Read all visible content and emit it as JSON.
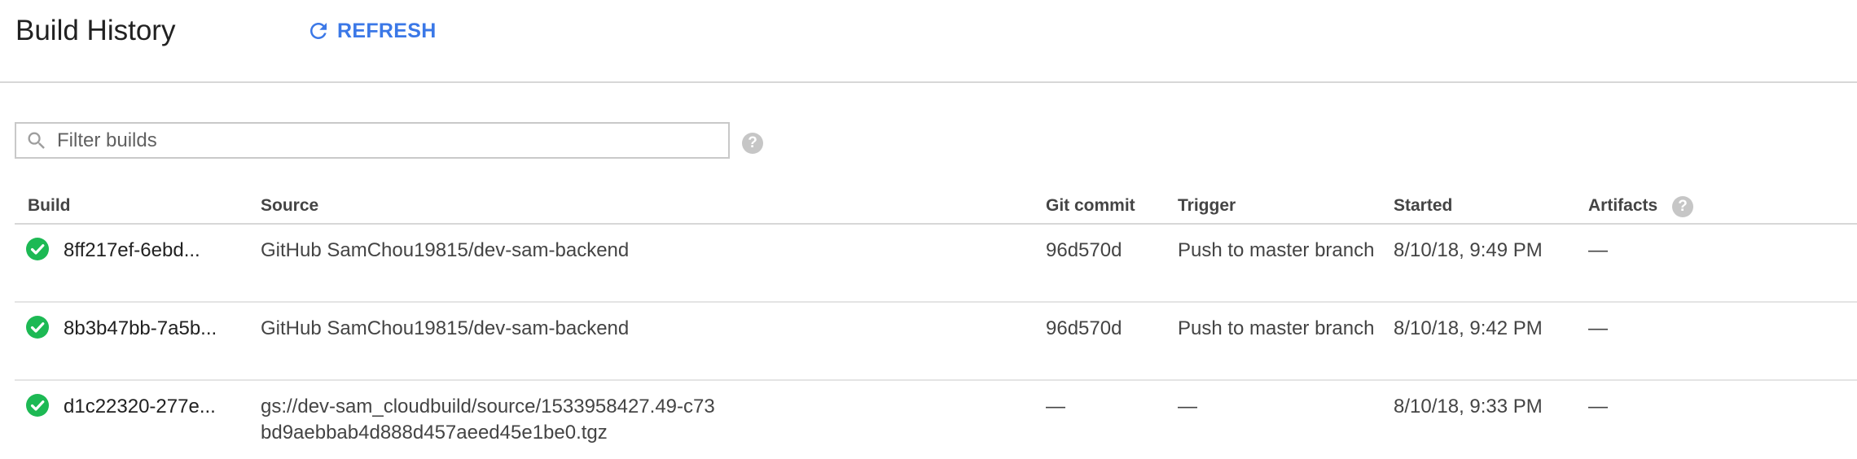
{
  "header": {
    "title": "Build History",
    "refresh_label": "REFRESH"
  },
  "filter": {
    "placeholder": "Filter builds",
    "value": ""
  },
  "colors": {
    "accent": "#3b78e7",
    "success": "#1db954",
    "help_icon": "#c6c6c6"
  },
  "icons": {
    "refresh": "refresh-icon",
    "search": "search-icon",
    "help": "help-icon",
    "status": "check-circle-icon"
  },
  "table": {
    "columns": {
      "build": "Build",
      "source": "Source",
      "git_commit": "Git commit",
      "trigger": "Trigger",
      "started": "Started",
      "artifacts": "Artifacts"
    },
    "rows": [
      {
        "status": "success",
        "build": "8ff217ef-6ebd...",
        "source": "GitHub SamChou19815/dev-sam-backend",
        "git_commit": "96d570d",
        "trigger": "Push to master branch",
        "started": "8/10/18, 9:49 PM",
        "artifacts": "—"
      },
      {
        "status": "success",
        "build": "8b3b47bb-7a5b...",
        "source": "GitHub SamChou19815/dev-sam-backend",
        "git_commit": "96d570d",
        "trigger": "Push to master branch",
        "started": "8/10/18, 9:42 PM",
        "artifacts": "—"
      },
      {
        "status": "success",
        "build": "d1c22320-277e...",
        "source": "gs://dev-sam_cloudbuild/source/1533958427.49-c73bd9aebbab4d888d457aeed45e1be0.tgz",
        "git_commit": "—",
        "trigger": "—",
        "started": "8/10/18, 9:33 PM",
        "artifacts": "—"
      }
    ]
  }
}
